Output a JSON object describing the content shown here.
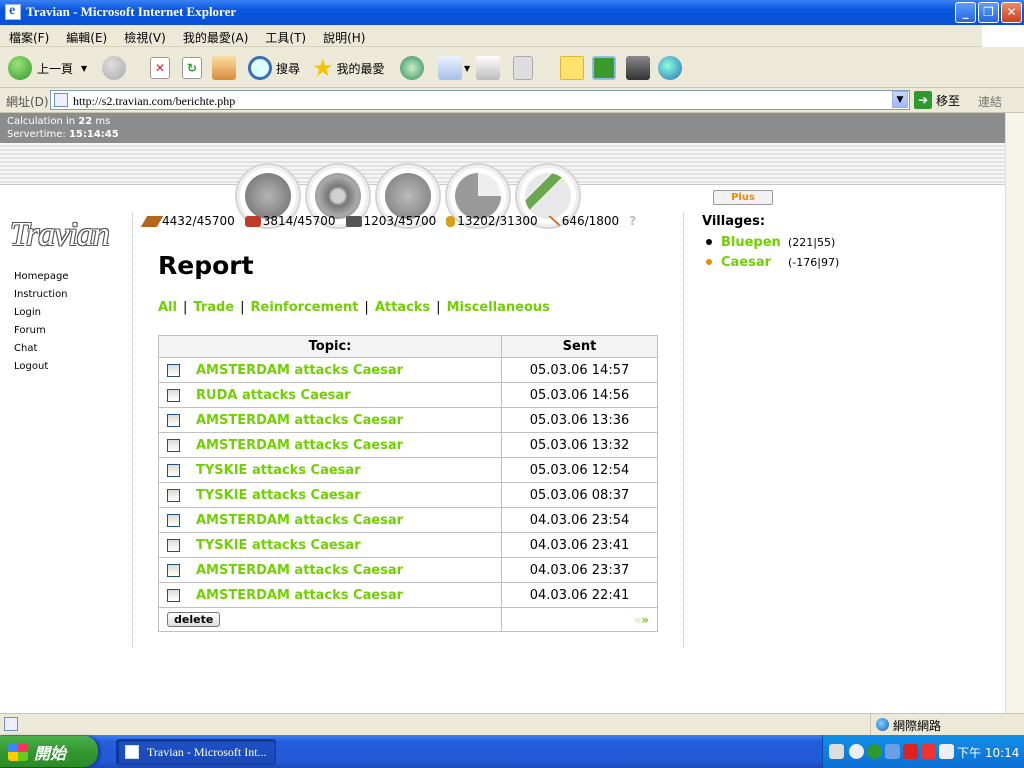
{
  "window": {
    "title": "Travian - Microsoft Internet Explorer"
  },
  "menu": [
    "檔案(F)",
    "編輯(E)",
    "檢視(V)",
    "我的最愛(A)",
    "工具(T)",
    "說明(H)"
  ],
  "toolbar": {
    "back_label": "上一頁",
    "search_label": "搜尋",
    "favorites_label": "我的最愛"
  },
  "address": {
    "label": "網址(D)",
    "url": "http://s2.travian.com/berichte.php",
    "go_label": "移至",
    "links_label": "連結"
  },
  "stats": {
    "calc_prefix": "Calculation in",
    "calc_ms": "22",
    "calc_unit": "ms",
    "servertime_label": "Servertime:",
    "servertime": "15:14:45"
  },
  "plus_label": "Plus",
  "logo_text": "Travian",
  "sidebar": {
    "items": [
      "Homepage",
      "Instruction",
      "Login",
      "Forum",
      "Chat",
      "Logout"
    ]
  },
  "resources": [
    {
      "name": "wood-icon",
      "value": "4432/45700",
      "color": "#b5651d"
    },
    {
      "name": "clay-icon",
      "value": "3814/45700",
      "color": "#c0392b"
    },
    {
      "name": "iron-icon",
      "value": "1203/45700",
      "color": "#555555"
    },
    {
      "name": "crop-icon",
      "value": "13202/31300",
      "color": "#d4a017"
    },
    {
      "name": "consumption-icon",
      "value": "646/1800",
      "color": "#e05a00"
    }
  ],
  "help_label": "?",
  "page_title": "Report",
  "filters": [
    "All",
    "Trade",
    "Reinforcement",
    "Attacks",
    "Miscellaneous"
  ],
  "table": {
    "headers": {
      "topic": "Topic:",
      "sent": "Sent"
    },
    "rows": [
      {
        "topic": "AMSTERDAM attacks Caesar",
        "sent": "05.03.06 14:57"
      },
      {
        "topic": "RUDA attacks Caesar",
        "sent": "05.03.06 14:56"
      },
      {
        "topic": "AMSTERDAM attacks Caesar",
        "sent": "05.03.06 13:36"
      },
      {
        "topic": "AMSTERDAM attacks Caesar",
        "sent": "05.03.06 13:32"
      },
      {
        "topic": "TYSKIE attacks Caesar",
        "sent": "05.03.06 12:54"
      },
      {
        "topic": "TYSKIE attacks Caesar",
        "sent": "05.03.06 08:37"
      },
      {
        "topic": "AMSTERDAM attacks Caesar",
        "sent": "04.03.06 23:54"
      },
      {
        "topic": "TYSKIE attacks Caesar",
        "sent": "04.03.06 23:41"
      },
      {
        "topic": "AMSTERDAM attacks Caesar",
        "sent": "04.03.06 23:37"
      },
      {
        "topic": "AMSTERDAM attacks Caesar",
        "sent": "04.03.06 22:41"
      }
    ],
    "delete_label": "delete",
    "pager_prev": "«",
    "pager_next": "»"
  },
  "villages": {
    "title": "Villages:",
    "list": [
      {
        "name": "Bluepen",
        "coords": "(221|55)",
        "bullet_color": "#000000"
      },
      {
        "name": "Caesar",
        "coords": "(-176|97)",
        "bullet_color": "#f08a00"
      }
    ]
  },
  "statusbar": {
    "zone": "網際網路"
  },
  "taskbar": {
    "start_label": "開始",
    "task_label": "Travian - Microsoft Int...",
    "clock": "下午 10:14"
  },
  "colors": {
    "link": "#71d000",
    "titlebar": "#0a56e0"
  }
}
